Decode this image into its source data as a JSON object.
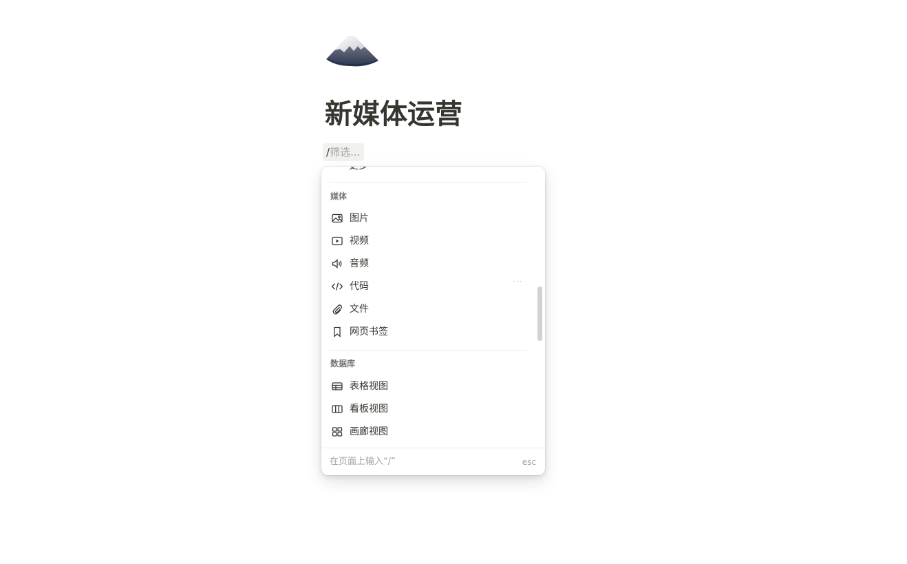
{
  "page": {
    "icon": "snow-capped-mountain-icon",
    "title": "新媒体运营",
    "slash_command": {
      "caret": "/",
      "placeholder": "筛选..."
    }
  },
  "menu": {
    "clipped_item_label": "更多",
    "sections": [
      {
        "label": "媒体",
        "items": [
          {
            "label": "图片",
            "icon": "image-icon"
          },
          {
            "label": "视频",
            "icon": "video-icon"
          },
          {
            "label": "音频",
            "icon": "audio-icon"
          },
          {
            "label": "代码",
            "icon": "code-icon"
          },
          {
            "label": "文件",
            "icon": "paperclip-icon"
          },
          {
            "label": "网页书签",
            "icon": "bookmark-icon"
          }
        ]
      },
      {
        "label": "数据库",
        "items": [
          {
            "label": "表格视图",
            "icon": "table-icon"
          },
          {
            "label": "看板视图",
            "icon": "board-icon"
          },
          {
            "label": "画廊视图",
            "icon": "gallery-icon"
          }
        ]
      }
    ],
    "more_indicator": "···",
    "footer": {
      "hint": "在页面上输入“/”",
      "esc": "esc"
    }
  },
  "colors": {
    "text": "#37352f",
    "muted": "#787774",
    "placeholder": "#a3a29e",
    "divider": "#ebebea",
    "scrollbar": "#d3d2cf"
  }
}
